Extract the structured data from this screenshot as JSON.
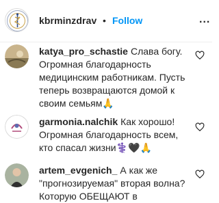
{
  "header": {
    "username": "kbrminzdrav",
    "separator": "•",
    "follow_label": "Follow",
    "more_label": "..."
  },
  "comments": [
    {
      "username": "katya_pro_schastie",
      "text": "Слава богу. Огромная благодарность медицинским работникам. Пусть теперь возвращаются домой к своим семьям🙏"
    },
    {
      "username": "garmonia.nalchik",
      "text": "Как хорошо! Огромная благодарность всем, кто спасал жизни⚕️🖤🙏"
    },
    {
      "username": "artem_evgenich_",
      "text": "А как же \"прогнозируемая\" вторая волна? Которую ОБЕЩАЮТ в"
    }
  ],
  "colors": {
    "accent": "#0095f6",
    "text": "#262626"
  }
}
